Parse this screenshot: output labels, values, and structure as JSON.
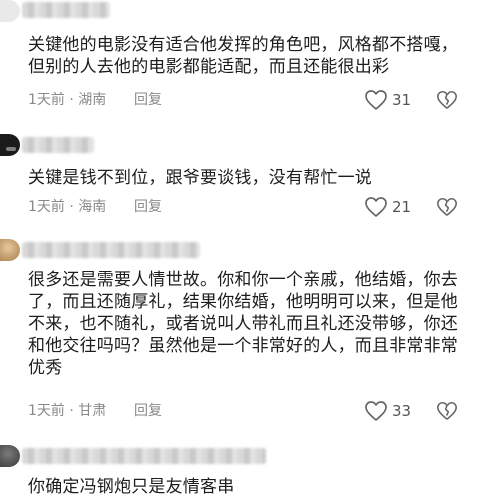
{
  "comments": [
    {
      "text": "关键他的电影没有适合他发挥的角色吧，风格都不搭嘎，但别的人去他的电影都能适配，而且还能很出彩",
      "meta": "1天前 · 湖南",
      "reply_label": "回复",
      "likes": "31"
    },
    {
      "text": "关键是钱不到位，跟爷要谈钱，没有帮忙一说",
      "meta": "1天前 · 海南",
      "reply_label": "回复",
      "likes": "21"
    },
    {
      "text": "很多还是需要人情世故。你和你一个亲戚，他结婚，你去了，而且还随厚礼，结果你结婚，他明明可以来，但是他不来，也不随礼，或者说叫人带礼而且礼还没带够，你还和他交往吗吗？虽然他是一个非常好的人，而且非常非常优秀",
      "meta": "1天前 · 甘肃",
      "reply_label": "回复",
      "likes": "33"
    },
    {
      "text": "你确定冯钢炮只是友情客串"
    }
  ],
  "icons": {
    "like": "heart-outline-icon",
    "dislike": "broken-heart-icon"
  }
}
